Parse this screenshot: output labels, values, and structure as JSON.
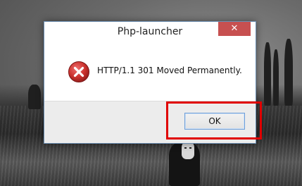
{
  "dialog": {
    "title": "Php-launcher",
    "close_label": "✕",
    "message": "HTTP/1.1 301 Moved Permanently.",
    "ok_label": "OK",
    "icon": "error-icon"
  },
  "colors": {
    "close_button": "#c75050",
    "error_icon": "#c9302c",
    "highlight": "#e00000",
    "ok_border": "#6f9fd8"
  }
}
